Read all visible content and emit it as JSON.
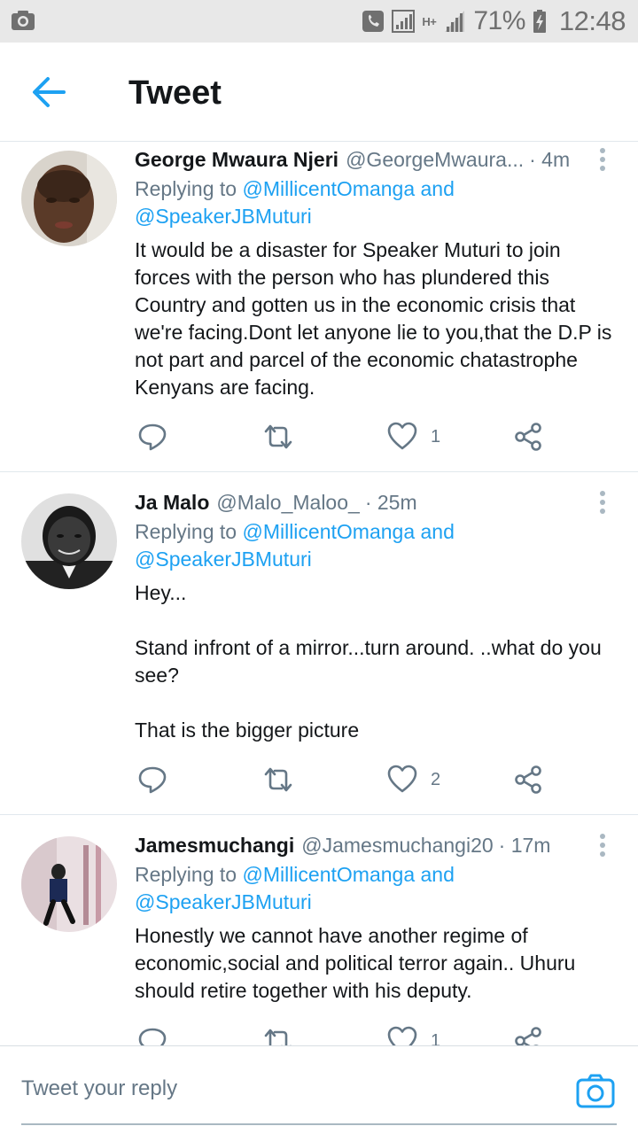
{
  "status_bar": {
    "battery": "71%",
    "time": "12:48",
    "network": "H+",
    "icons": [
      "camera-icon",
      "phone-call-icon",
      "signal-icon",
      "data-signal-icon",
      "battery-charging-icon"
    ]
  },
  "header": {
    "title": "Tweet",
    "back_icon": "arrow-left-icon"
  },
  "colors": {
    "accent": "#1da1f2",
    "text_primary": "#14171a",
    "text_secondary": "#657786",
    "divider": "#e1e8ed",
    "statusbar": "#e8e8e8"
  },
  "tweets": [
    {
      "name": "George Mwaura Njeri",
      "handle": "@GeorgeMwaura...",
      "time": "· 4m",
      "replying_prefix": "Replying to ",
      "replying_to_1": "@MillicentOmanga and",
      "replying_to_2": "@SpeakerJBMuturi",
      "body": "It would be a disaster for Speaker Muturi to join forces with the person who has plundered this Country and gotten us in the economic crisis that we're facing.Dont let anyone lie to you,that the D.P is not part and parcel of the economic chatastrophe Kenyans are facing.",
      "like_count": "1"
    },
    {
      "name": "Ja Malo",
      "handle": "@Malo_Maloo_",
      "time": "· 25m",
      "replying_prefix": "Replying to ",
      "replying_to_1": "@MillicentOmanga and",
      "replying_to_2": "@SpeakerJBMuturi",
      "body": "Hey...\n\nStand infront of a mirror...turn around. ..what do you see?\n\nThat is the bigger picture",
      "like_count": "2"
    },
    {
      "name": "Jamesmuchangi",
      "handle": "@Jamesmuchangi20",
      "time": "· 17m",
      "replying_prefix": "Replying to ",
      "replying_to_1": "@MillicentOmanga and",
      "replying_to_2": "@SpeakerJBMuturi",
      "body": "Honestly we cannot have another regime of economic,social and political terror again.. Uhuru should retire together with his deputy.",
      "like_count": "1"
    }
  ],
  "composer": {
    "placeholder": "Tweet your reply",
    "camera_icon": "camera-icon"
  }
}
